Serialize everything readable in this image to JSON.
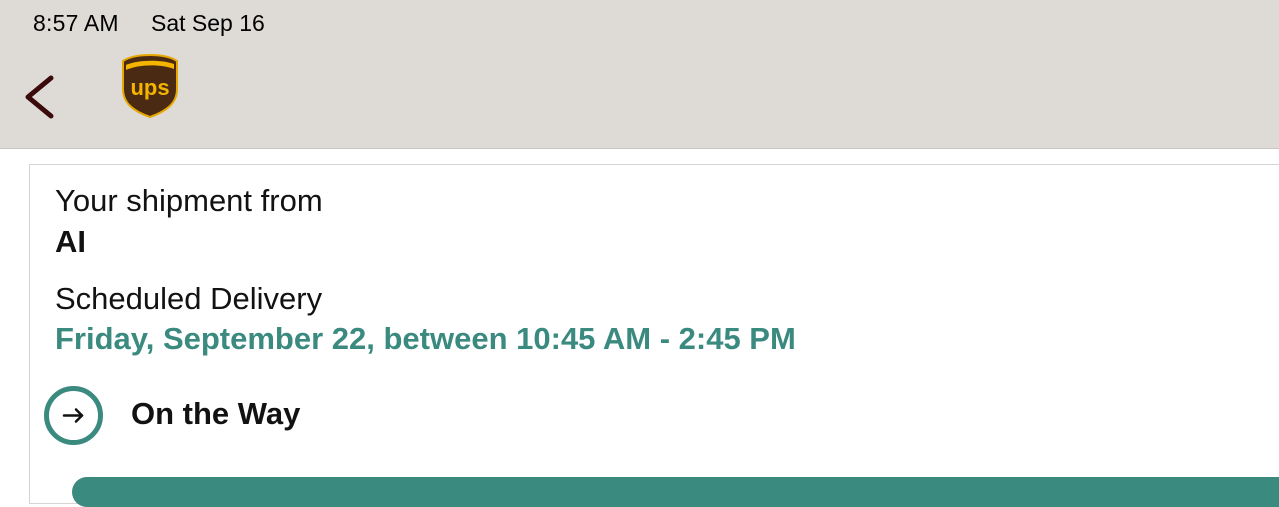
{
  "status_bar": {
    "time": "8:57 AM",
    "date": "Sat Sep 16"
  },
  "header": {
    "back_icon": "chevron-left-icon",
    "logo_text": "ups"
  },
  "shipment": {
    "from_label": "Your shipment from",
    "shipper": "AI",
    "delivery_label": "Scheduled Delivery",
    "delivery_window": "Friday, September 22, between 10:45 AM - 2:45 PM",
    "status": "On the Way",
    "status_icon": "arrow-right-circle-icon"
  },
  "colors": {
    "accent": "#3b8a80",
    "header_bg": "#dedbd7",
    "back_icon": "#3b0a0a",
    "ups_brown": "#4a2a12",
    "ups_gold": "#f4b400"
  }
}
